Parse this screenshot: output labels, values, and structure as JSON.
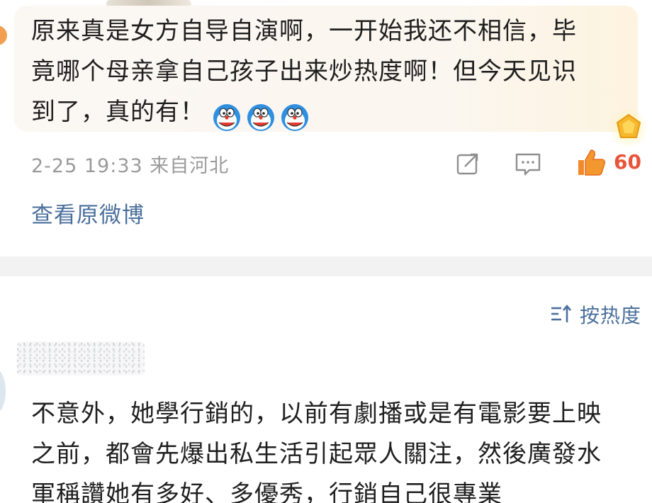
{
  "top_comment": {
    "text": "原来真是女方自导自演啊，一开始我还不相信，毕\n竟哪个母亲拿自己孩子出来炒热度啊！但今天见识\n到了，真的有！",
    "emojis": [
      "doraemon-emoji",
      "doraemon-emoji",
      "doraemon-emoji"
    ],
    "timestamp": "2-25 19:33 来自河北",
    "like_count": "60",
    "view_original_link": "查看原微博"
  },
  "sort": {
    "label": "按热度"
  },
  "second_comment": {
    "text": "不意外，她學行銷的，以前有劇播或是有電影要上映\n之前，都會先爆出私生活引起眾人關注，然後廣發水\n軍稱讚她有多好、多優秀，行銷自己很專業"
  },
  "colors": {
    "link_blue": "#4a6f9c",
    "like_red": "#e8543a",
    "meta_gray": "#9a9a9a",
    "divider_gray": "#f2f2f2"
  }
}
